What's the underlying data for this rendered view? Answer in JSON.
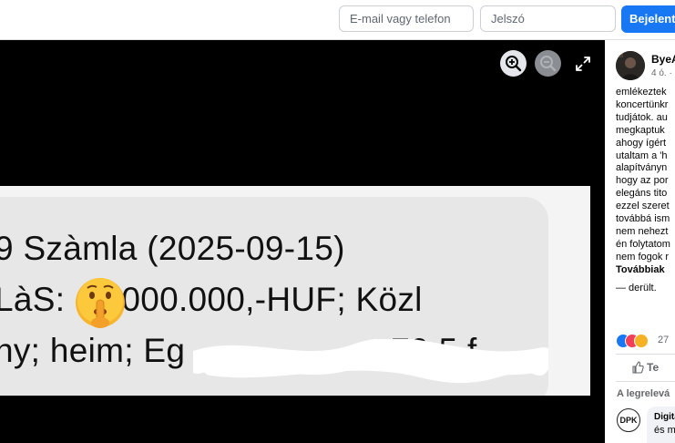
{
  "header": {
    "email_placeholder": "E-mail vagy telefon",
    "password_placeholder": "Jelszó",
    "login_label": "Bejelentk"
  },
  "photo": {
    "line1": "9 Szàmla (2025-09-15)",
    "line2_prefix": "LàS:",
    "line2_suffix": "000.000,-HUF; Közl",
    "line3": "ny; heim; Eg",
    "line3_tail": "79.5 f",
    "emoji_name": "shushing-face-emoji",
    "redaction": "white-scribble"
  },
  "post": {
    "author": "ByeA",
    "time": "4 ó. ·",
    "lines": [
      "emlékeztek",
      "koncertünkr",
      "tudjátok. au",
      "megkaptuk",
      "ahogy ígért",
      "utaltam a 'h",
      "alapítványn",
      "hogy az por",
      "elegáns tito",
      "ezzel szeret",
      "továbbá ism",
      "nem nehezt",
      "én folytatom",
      "nem fogok r"
    ],
    "see_more": "Továbbiak",
    "feeling": "— derült.",
    "reaction_count": "27",
    "like_label": "Te",
    "relevant_label": "A legrelevá",
    "comment": {
      "avatar_text": "DPK",
      "name": "Digita",
      "text": "és m"
    }
  },
  "colors": {
    "brand_blue": "#1877f2",
    "viewer_bg": "#000000"
  }
}
